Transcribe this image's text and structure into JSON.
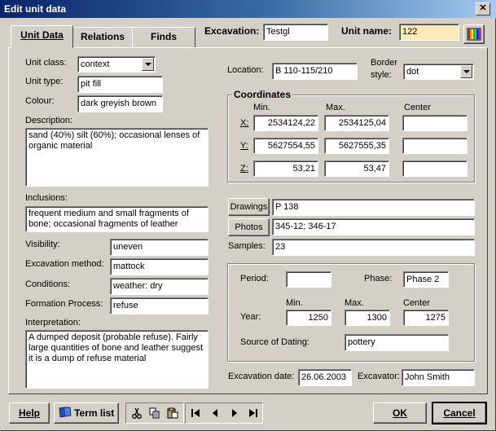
{
  "window": {
    "title": "Edit unit data",
    "close_glyph": "✕"
  },
  "tabs": [
    {
      "label": "Unit Data"
    },
    {
      "label": "Relations"
    },
    {
      "label": "Finds"
    }
  ],
  "header": {
    "excavation_label": "Excavation:",
    "excavation_value": "Testgl",
    "unit_name_label": "Unit name:",
    "unit_name_value": "122"
  },
  "left": {
    "unit_class_label": "Unit class:",
    "unit_class_value": "context",
    "unit_type_label": "Unit type:",
    "unit_type_value": "pit fill",
    "colour_label": "Colour:",
    "colour_value": "dark greyish brown",
    "description_label": "Description:",
    "description_value": "sand (40%) silt (60%); occasional lenses of organic material",
    "inclusions_label": "Inclusions:",
    "inclusions_value": "frequent medium and small fragments of bone; occasional fragments of leather",
    "visibility_label": "Visibility:",
    "visibility_value": "uneven",
    "method_label": "Excavation method:",
    "method_value": "mattock",
    "conditions_label": "Conditions:",
    "conditions_value": "weather: dry",
    "formation_label": "Formation Process:",
    "formation_value": "refuse",
    "interpretation_label": "Interpretation:",
    "interpretation_value": "A dumped deposit (probable refuse). Fairly large quantities of bone and leather suggest it is a dump of refuse material"
  },
  "right": {
    "location_label": "Location:",
    "location_value": "B 110-115/210",
    "border_style_label": "Border style:",
    "border_style_value": "dot",
    "coordinates": {
      "title": "Coordinates",
      "min_label": "Min.",
      "max_label": "Max.",
      "center_label": "Center",
      "rows": [
        {
          "axis": "X:",
          "min": "2534124,22",
          "max": "2534125,04",
          "center": ""
        },
        {
          "axis": "Y:",
          "min": "5627554,55",
          "max": "5627555,35",
          "center": ""
        },
        {
          "axis": "Z:",
          "min": "53,21",
          "max": "53,47",
          "center": ""
        }
      ]
    },
    "drawings_button": "Drawings",
    "drawings_value": "P 138",
    "photos_button": "Photos",
    "photos_value": "345-12; 346-17",
    "samples_label": "Samples:",
    "samples_value": "23",
    "dating": {
      "period_label": "Period:",
      "period_value": "",
      "phase_label": "Phase:",
      "phase_value": "Phase 2",
      "min_label": "Min.",
      "max_label": "Max.",
      "center_label": "Center",
      "year_label": "Year:",
      "year_min": "1250",
      "year_max": "1300",
      "year_center": "1275",
      "source_label": "Source of Dating:",
      "source_value": "pottery"
    },
    "excavation_date_label": "Excavation date:",
    "excavation_date_value": "26.06.2003",
    "excavator_label": "Excavator:",
    "excavator_value": "John Smith"
  },
  "footer": {
    "help_label": "Help",
    "term_list_label": "Term list",
    "ok_label": "OK",
    "cancel_label": "Cancel"
  }
}
